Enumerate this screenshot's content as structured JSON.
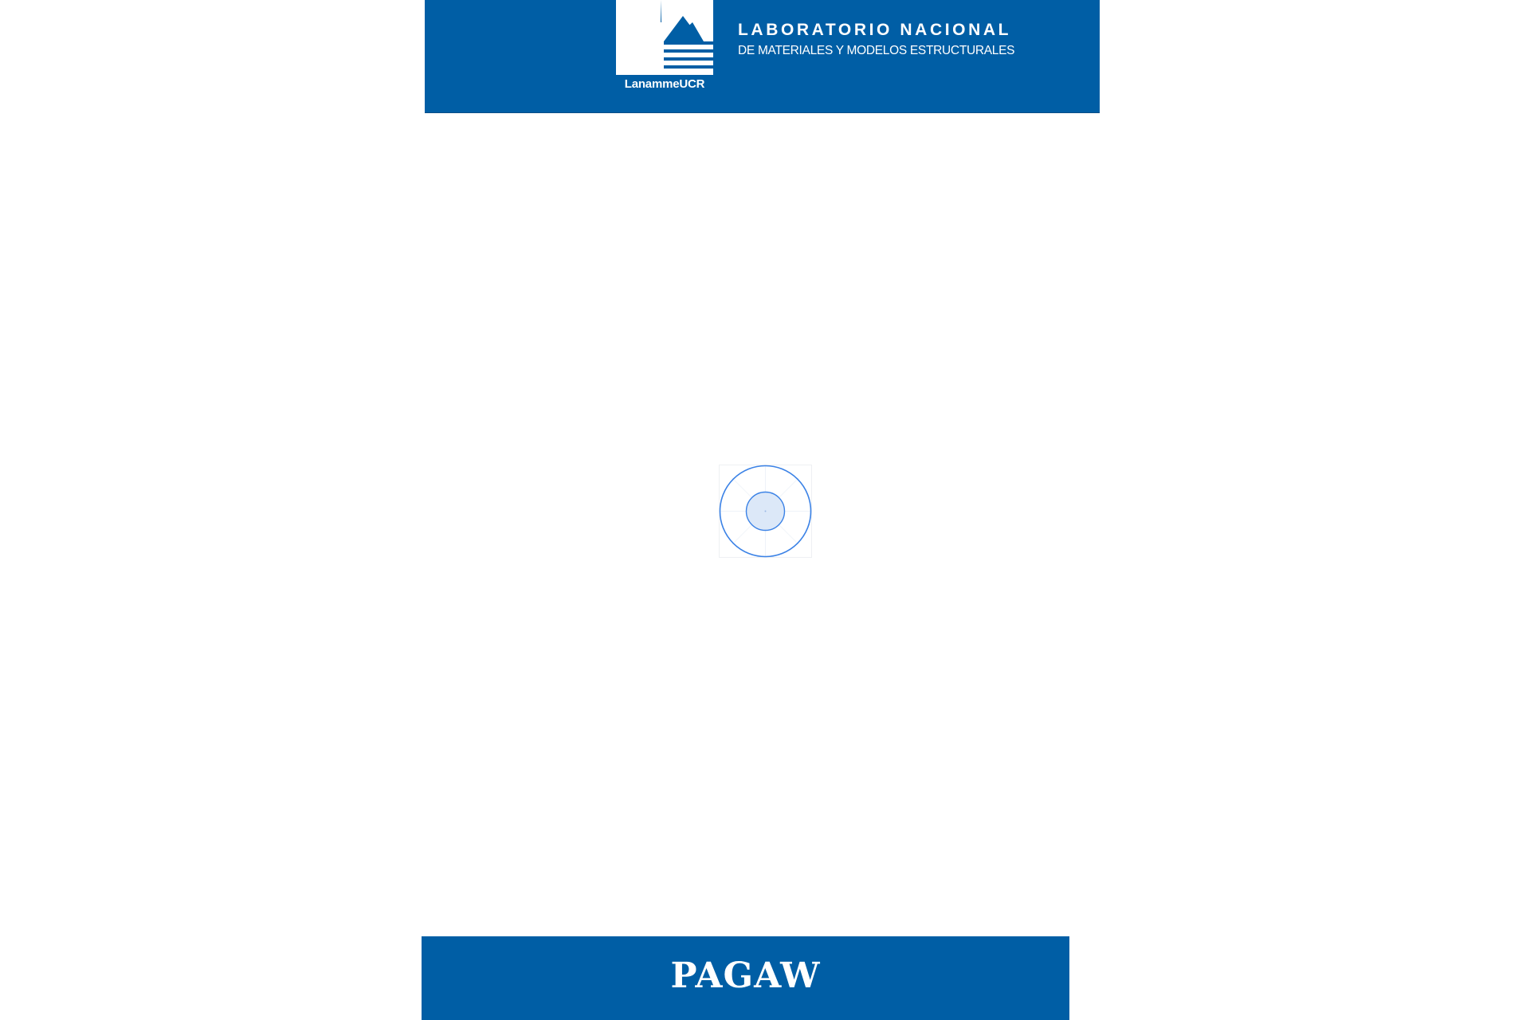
{
  "header": {
    "logo_caption": "LanammeUCR",
    "title": "LABORATORIO NACIONAL",
    "subtitle": "DE MATERIALES Y MODELOS ESTRUCTURALES",
    "logo_icon": "lanamme-logo-icon"
  },
  "loading": {
    "icon": "loading-spinner-icon"
  },
  "footer": {
    "title": "PAGAW"
  },
  "colors": {
    "brand_blue": "#005ea5",
    "spinner_blue": "#3b82e6",
    "spinner_fill": "#dce8f8",
    "text_white": "#ffffff"
  }
}
